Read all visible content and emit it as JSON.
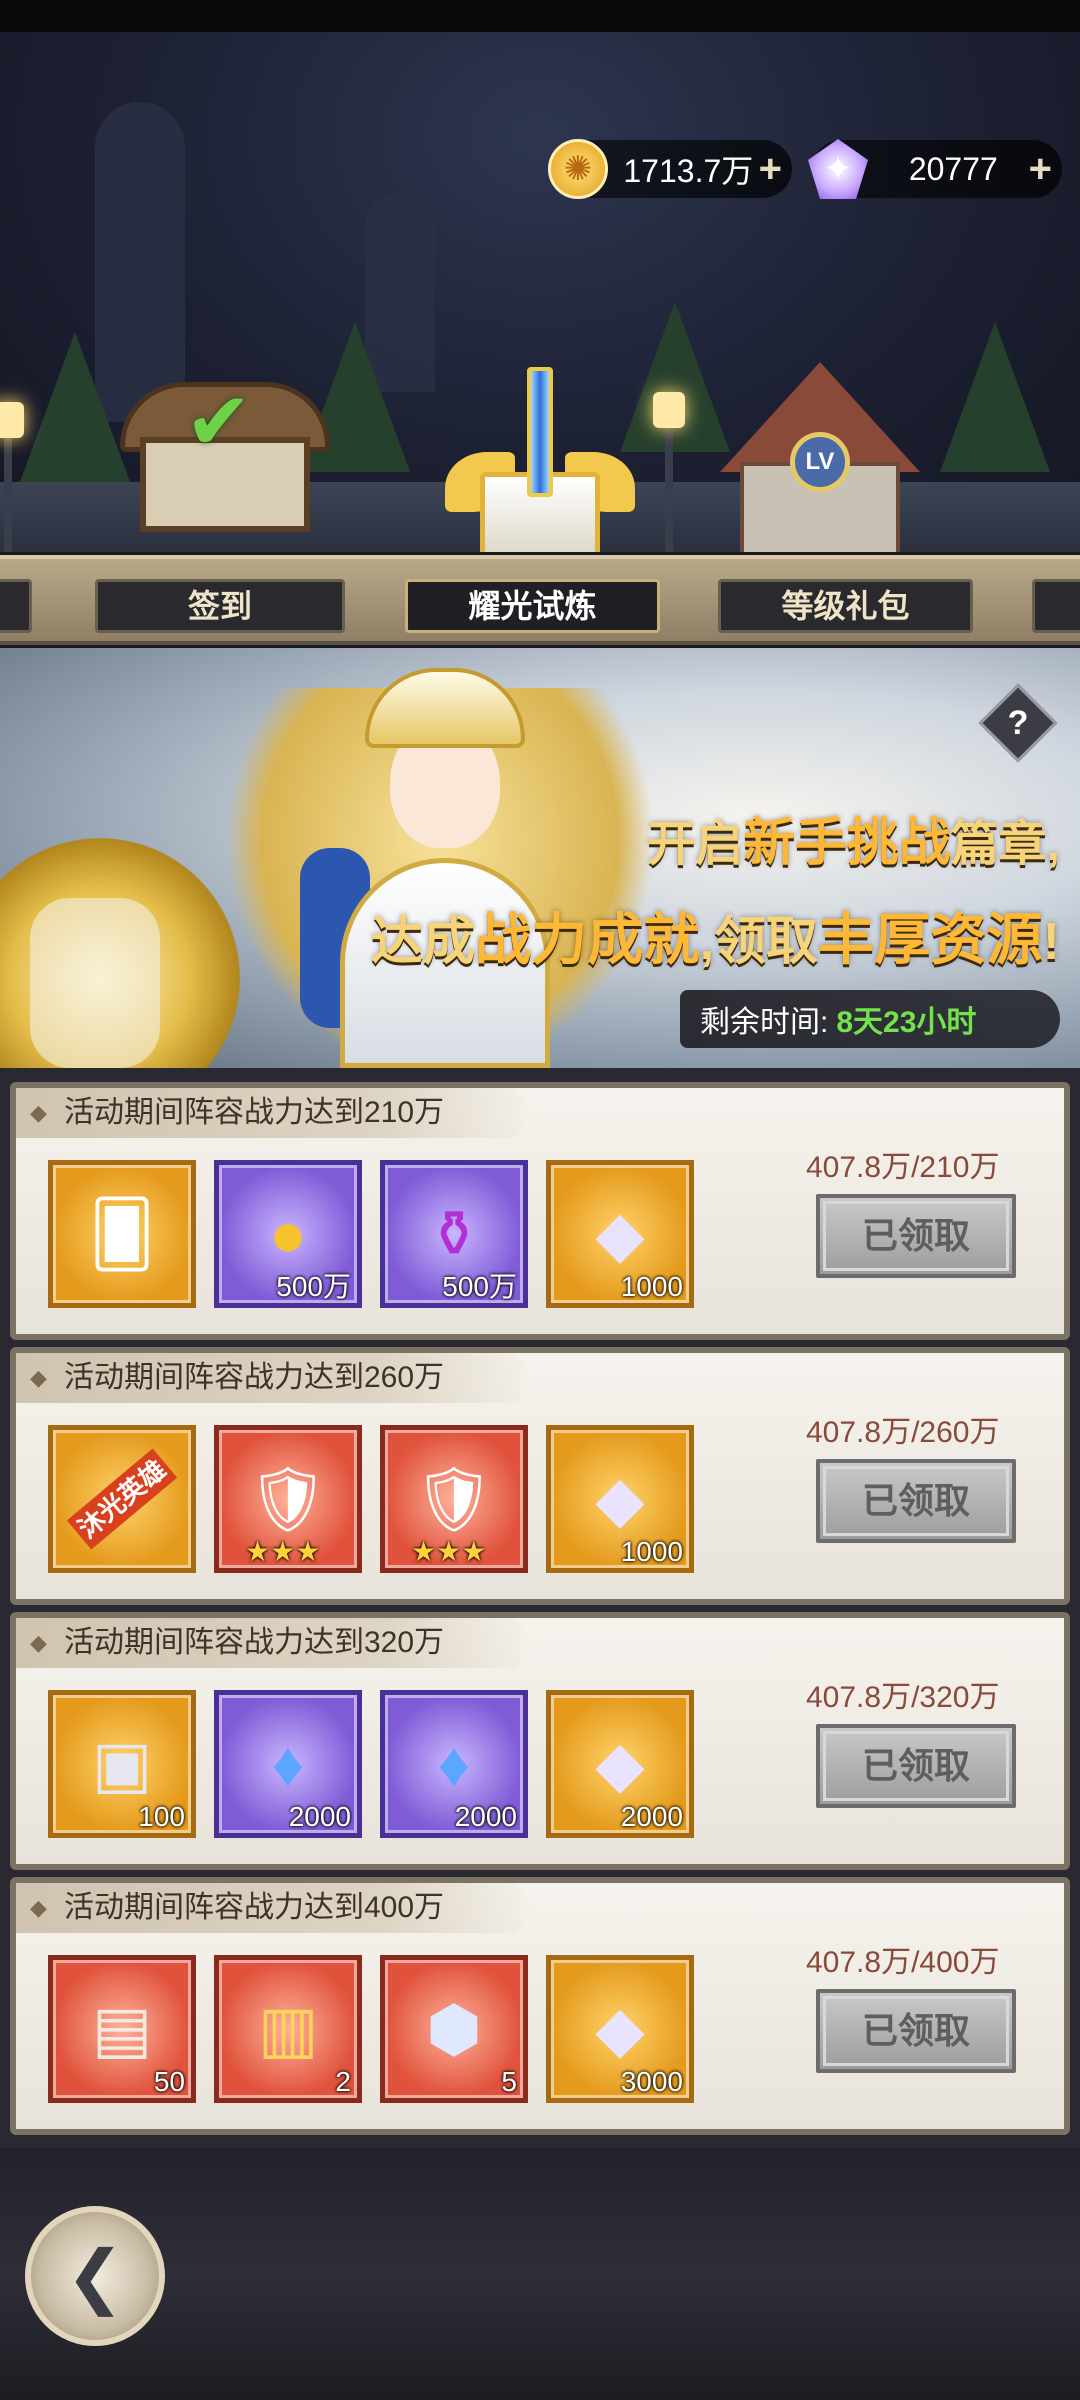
{
  "currency": {
    "coins": "1713.7万",
    "gems": "20777",
    "plus": "+"
  },
  "tabs": [
    {
      "label": ""
    },
    {
      "label": "签到"
    },
    {
      "label": "耀光试炼"
    },
    {
      "label": "等级礼包"
    },
    {
      "label": ""
    }
  ],
  "banner": {
    "help": "?",
    "slogan_line1_pre": "开启",
    "slogan_line1_hl": "新手挑战",
    "slogan_line1_post": "篇章,",
    "slogan_line2_pre": "达成",
    "slogan_line2_hl1": "战力成就",
    "slogan_line2_mid": ",领取",
    "slogan_line2_hl2": "丰厚资源",
    "slogan_line2_post": "!",
    "timer_label": "剩余时间:",
    "timer_value": "8天23小时"
  },
  "tasks": [
    {
      "title": "活动期间阵容战力达到210万",
      "progress": "407.8万/210万",
      "button": "已领取",
      "items": [
        {
          "icon": "hero-card-icon",
          "qty": ""
        },
        {
          "icon": "gold-coin-icon",
          "qty": "500万"
        },
        {
          "icon": "potion-icon",
          "qty": "500万"
        },
        {
          "icon": "diamond-icon",
          "qty": "1000"
        }
      ]
    },
    {
      "title": "活动期间阵容战力达到260万",
      "progress": "407.8万/260万",
      "button": "已领取",
      "items": [
        {
          "icon": "hero-badge-icon",
          "qty": "",
          "badge": "沐光英雄"
        },
        {
          "icon": "equipment-chest-icon",
          "qty": "",
          "stars": "★★★"
        },
        {
          "icon": "equipment-chest-icon",
          "qty": "",
          "stars": "★★★"
        },
        {
          "icon": "diamond-icon",
          "qty": "1000"
        }
      ]
    },
    {
      "title": "活动期间阵容战力达到320万",
      "progress": "407.8万/320万",
      "button": "已领取",
      "items": [
        {
          "icon": "silver-chest-icon",
          "qty": "100"
        },
        {
          "icon": "blue-crystal-icon",
          "qty": "2000"
        },
        {
          "icon": "blue-crystal-icon",
          "qty": "2000"
        },
        {
          "icon": "diamond-icon",
          "qty": "2000"
        }
      ]
    },
    {
      "title": "活动期间阵容战力达到400万",
      "progress": "407.8万/400万",
      "button": "已领取",
      "items": [
        {
          "icon": "treasure-chest-icon",
          "qty": "50"
        },
        {
          "icon": "red-chest-icon",
          "qty": "2"
        },
        {
          "icon": "cube-crystal-icon",
          "qty": "5"
        },
        {
          "icon": "diamond-icon",
          "qty": "3000"
        }
      ]
    }
  ]
}
